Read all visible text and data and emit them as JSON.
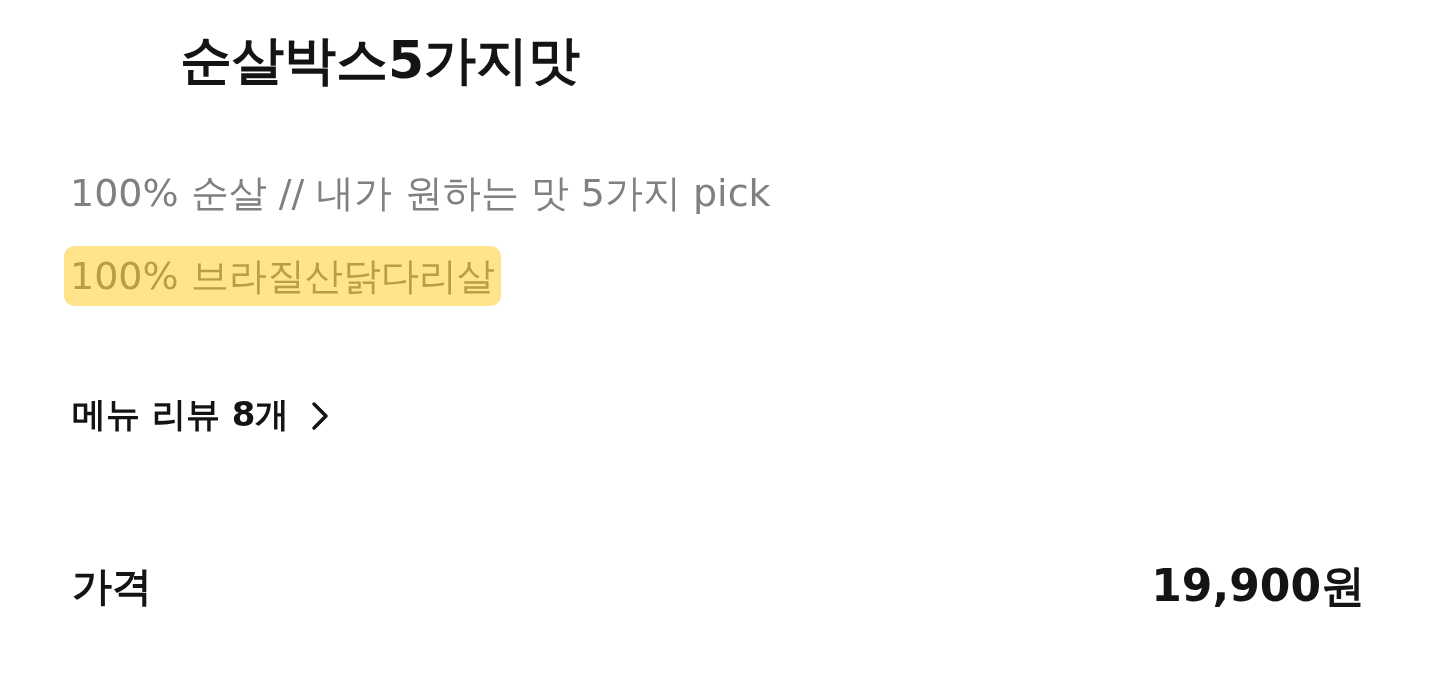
{
  "title": "순살박스5가지맛",
  "description": "100% 순살 // 내가 원하는 맛 5가지 pick",
  "highlight": {
    "text": "100% 브라질산닭다리살"
  },
  "review_link": {
    "label": "메뉴 리뷰 8개"
  },
  "price": {
    "label": "가격",
    "value": "19,900원"
  }
}
